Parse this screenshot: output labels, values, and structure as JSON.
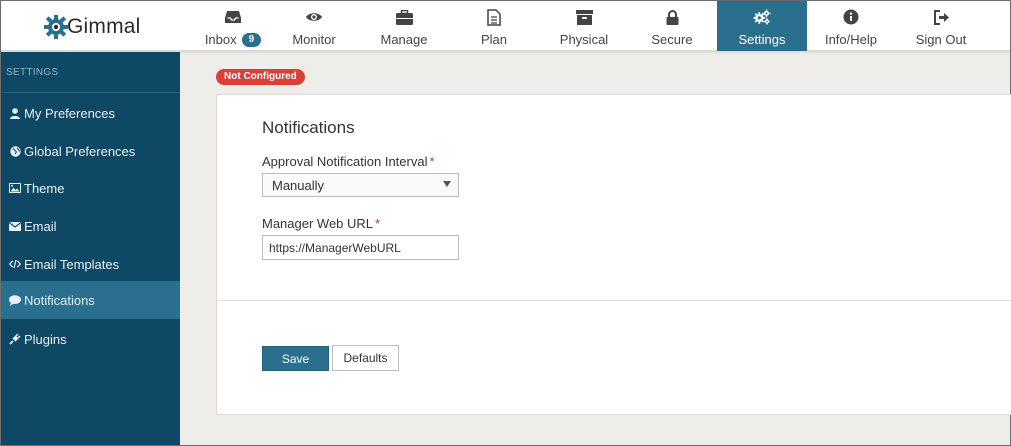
{
  "brand": {
    "logo_text": "Gimmal"
  },
  "nav": {
    "items": [
      {
        "label": "Inbox",
        "icon": "inbox-icon",
        "badge": "9"
      },
      {
        "label": "Monitor",
        "icon": "eye-icon"
      },
      {
        "label": "Manage",
        "icon": "briefcase-icon"
      },
      {
        "label": "Plan",
        "icon": "document-icon"
      },
      {
        "label": "Physical",
        "icon": "archive-box-icon"
      },
      {
        "label": "Secure",
        "icon": "lock-icon"
      },
      {
        "label": "Settings",
        "icon": "gears-icon",
        "active": true
      },
      {
        "label": "Info/Help",
        "icon": "info-icon"
      },
      {
        "label": "Sign Out",
        "icon": "sign-out-icon"
      }
    ]
  },
  "sidebar": {
    "heading": "SETTINGS",
    "items": [
      {
        "label": "My Preferences",
        "icon": "user-icon"
      },
      {
        "label": "Global Preferences",
        "icon": "globe-icon"
      },
      {
        "label": "Theme",
        "icon": "image-icon"
      },
      {
        "label": "Email",
        "icon": "envelope-icon"
      },
      {
        "label": "Email Templates",
        "icon": "code-icon"
      },
      {
        "label": "Notifications",
        "icon": "comment-icon",
        "active": true
      },
      {
        "label": "Plugins",
        "icon": "plug-icon"
      }
    ]
  },
  "main": {
    "status_badge": "Not Configured",
    "title": "Notifications",
    "interval_label": "Approval Notification Interval",
    "interval_value": "Manually",
    "url_label": "Manager Web URL",
    "url_value": "https://ManagerWebURL",
    "required_mark": "*",
    "save_label": "Save",
    "defaults_label": "Defaults"
  },
  "colors": {
    "accent": "#2a6f8e",
    "sidebar_bg": "#0f4864",
    "danger": "#d9403a",
    "page_bg": "#efedea"
  }
}
